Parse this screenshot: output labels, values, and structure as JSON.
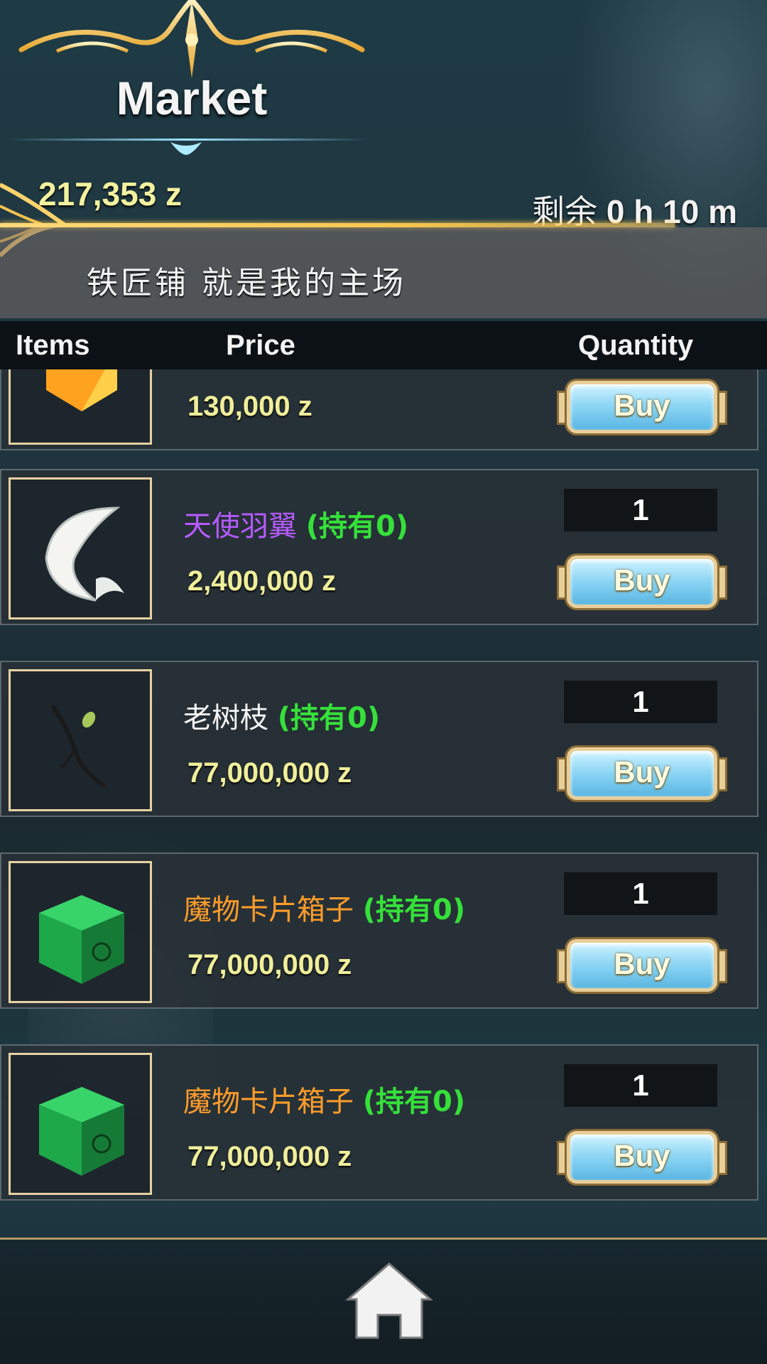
{
  "header": {
    "title": "Market",
    "money": "217,353 z",
    "timer_prefix": "剩余",
    "timer_value": "0 h 10 m"
  },
  "notice": {
    "text": "铁匠铺 就是我的主场"
  },
  "columns": {
    "items": "Items",
    "price": "Price",
    "quantity": "Quantity"
  },
  "items": [
    {
      "name": "",
      "held": "",
      "price": "130,000 z",
      "quantity": "",
      "buy": "Buy",
      "name_color": "#ffffff",
      "icon": "orange-gem-icon"
    },
    {
      "name": "天使羽翼",
      "held": "(持有0)",
      "price": "2,400,000 z",
      "quantity": "1",
      "buy": "Buy",
      "name_color": "#b65bff",
      "icon": "angel-wing-icon"
    },
    {
      "name": "老树枝",
      "held": "(持有0)",
      "price": "77,000,000 z",
      "quantity": "1",
      "buy": "Buy",
      "name_color": "#f4f4f4",
      "icon": "old-branch-icon"
    },
    {
      "name": "魔物卡片箱子",
      "held": "(持有0)",
      "price": "77,000,000 z",
      "quantity": "1",
      "buy": "Buy",
      "name_color": "#ff9c2a",
      "icon": "card-box-icon"
    },
    {
      "name": "魔物卡片箱子",
      "held": "(持有0)",
      "price": "77,000,000 z",
      "quantity": "1",
      "buy": "Buy",
      "name_color": "#ff9c2a",
      "icon": "card-box-icon"
    }
  ],
  "footer": {
    "home_icon": "home-icon"
  }
}
